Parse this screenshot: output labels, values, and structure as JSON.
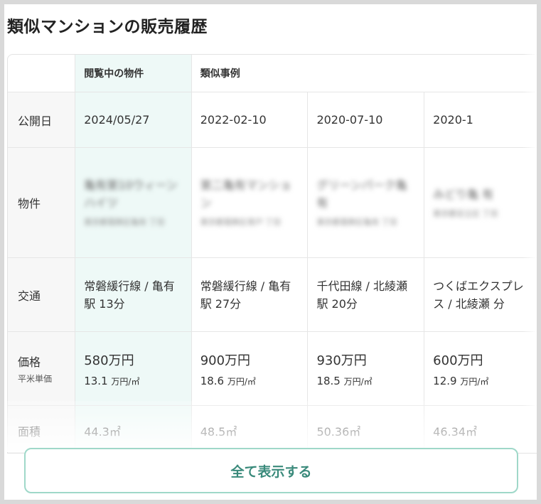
{
  "title": "類似マンションの販売履歴",
  "headers": {
    "current": "閲覧中の物件",
    "similar": "類似事例"
  },
  "rows": {
    "date": {
      "label": "公開日",
      "values": [
        "2024/05/27",
        "2022-02-10",
        "2020-07-10",
        "2020-1"
      ]
    },
    "property": {
      "label": "物件",
      "items": [
        {
          "name": "亀有第10ウィーン ハイツ",
          "address": "東京都葛飾区亀有 丁目"
        },
        {
          "name": "第二亀有マンショ ン",
          "address": "東京都葛飾区青戸 丁目"
        },
        {
          "name": "グリーンパーク亀 有",
          "address": "東京都葛飾区亀有 丁目"
        },
        {
          "name": "みどり亀 有",
          "address": "東京都足立区 丁目"
        }
      ]
    },
    "traffic": {
      "label": "交通",
      "values": [
        "常磐緩行線 / 亀有駅 13分",
        "常磐緩行線 / 亀有駅 27分",
        "千代田線 / 北綾瀬駅 20分",
        "つくばエクスプレス / 北綾瀬 分"
      ]
    },
    "price": {
      "label": "価格",
      "sub_label": "平米単価",
      "values": [
        "580万円",
        "900万円",
        "930万円",
        "600万円"
      ],
      "unit_prices": [
        "13.1",
        "18.6",
        "18.5",
        "12.9"
      ],
      "unit": "万円/㎡"
    },
    "area": {
      "label": "面積",
      "values": [
        "44.3㎡",
        "48.5㎡",
        "50.36㎡",
        "46.34㎡"
      ]
    }
  },
  "show_all_label": "全て表示する",
  "colors": {
    "highlight": "#eef9f7",
    "accent": "#3a8a7b",
    "button_border": "#9fd8c9"
  }
}
